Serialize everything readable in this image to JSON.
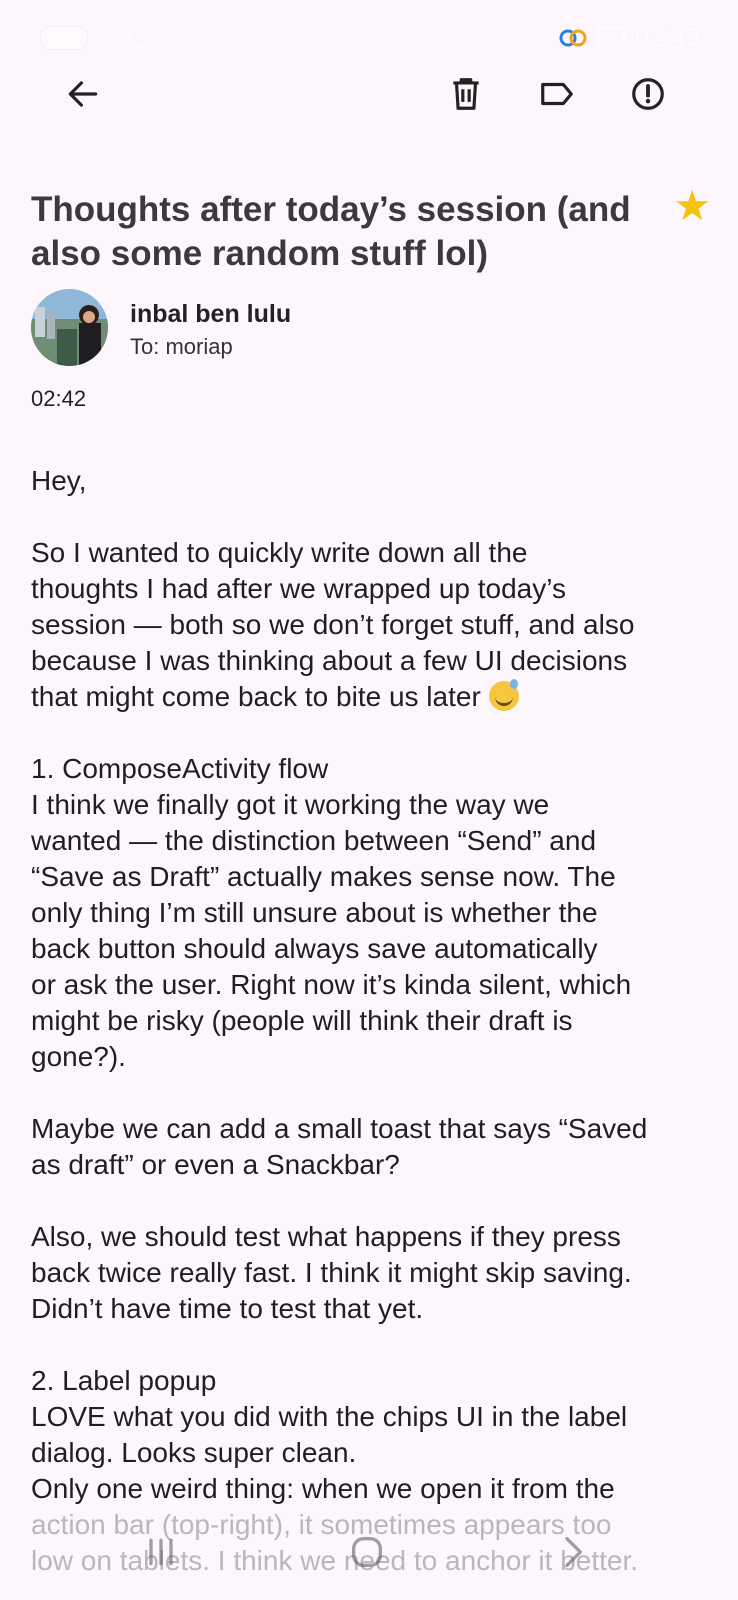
{
  "status_bar": {
    "time": "02:49"
  },
  "app_bar": {
    "back_icon": "arrow-left-icon",
    "delete_icon": "trash-icon",
    "label_icon": "label-icon",
    "report_icon": "alert-circle-icon"
  },
  "email": {
    "subject": "Thoughts after today’s session (and also some random stuff lol)",
    "starred": true,
    "star_color": "#f7c20e",
    "sender_name": "inbal ben lulu",
    "recipient": "To: moriap",
    "time": "02:42",
    "body": {
      "p1": [
        "Hey,"
      ],
      "p2": [
        "So I wanted to quickly write down all the",
        "thoughts I had after we wrapped up today’s",
        "session — both so we don’t forget stuff, and also",
        "because I was thinking about a few UI decisions",
        "that might come back to bite us later"
      ],
      "p3": [
        "1. ComposeActivity flow",
        "I think we finally got it working the way we",
        "wanted — the distinction between “Send” and",
        "“Save as Draft” actually makes sense now. The",
        "only thing I’m still unsure about is whether the",
        "back button should always save automatically",
        "or ask the user. Right now it’s kinda silent, which",
        "might be risky (people will think their draft is",
        "gone?)."
      ],
      "p4": [
        "Maybe we can add a small toast that says “Saved",
        "as draft” or even a Snackbar?"
      ],
      "p5": [
        "Also, we should test what happens if they press",
        "back twice really fast. I think it might skip saving.",
        "Didn’t have time to test that yet."
      ],
      "p6": [
        "2. Label popup",
        "LOVE what you did with the chips UI in the label",
        "dialog. Looks super clean.",
        "Only one weird thing: when we open it from the",
        "action bar (top-right), it sometimes appears too",
        "low on tablets. I think we need to anchor it better."
      ]
    }
  },
  "nav_bar": {
    "recents_icon": "recents-icon",
    "home_icon": "home-icon",
    "back_icon": "nav-back-icon"
  }
}
